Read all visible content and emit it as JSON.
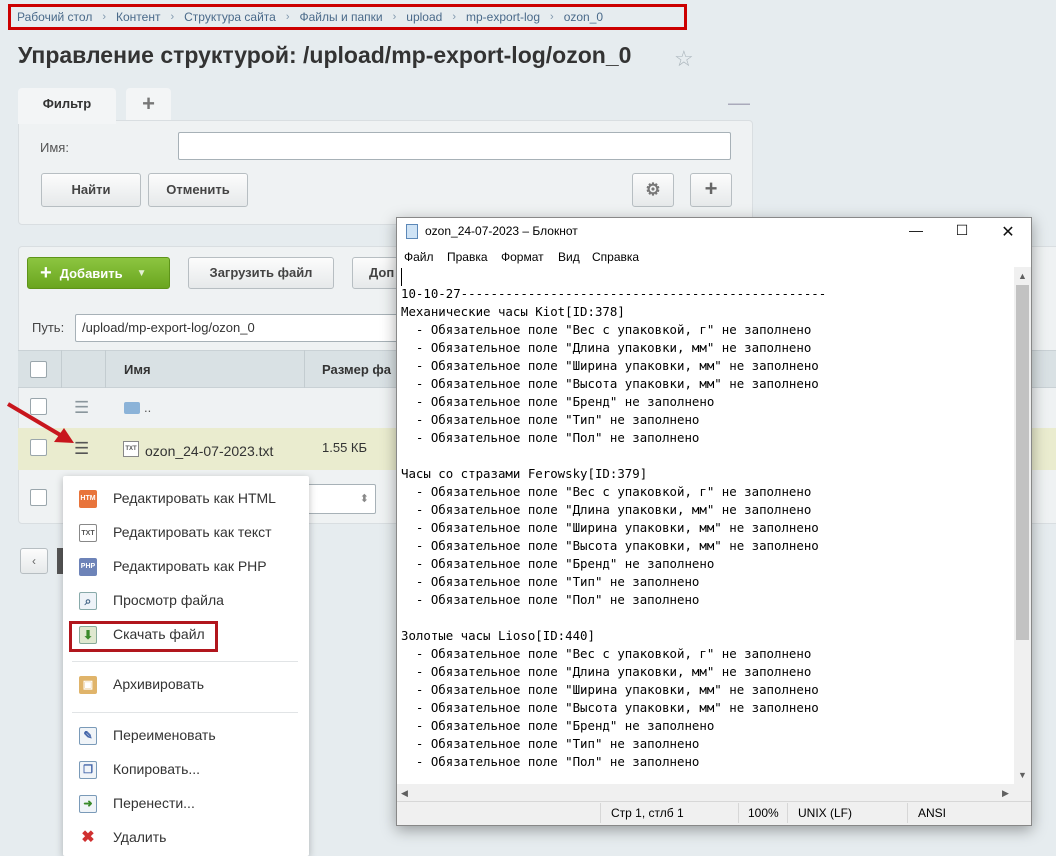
{
  "breadcrumb": [
    "Рабочий стол",
    "Контент",
    "Структура сайта",
    "Файлы и папки",
    "upload",
    "mp-export-log",
    "ozon_0"
  ],
  "page_title": "Управление структурой: /upload/mp-export-log/ozon_0",
  "filter": {
    "tab_label": "Фильтр",
    "name_label": "Имя:",
    "name_value": "",
    "find_label": "Найти",
    "cancel_label": "Отменить"
  },
  "toolbar": {
    "add_label": "Добавить",
    "upload_label": "Загрузить файл",
    "more_label": "Доп"
  },
  "path": {
    "label": "Путь:",
    "value": "/upload/mp-export-log/ozon_0"
  },
  "table": {
    "columns": [
      "Имя",
      "Размер фа"
    ],
    "parent": "..",
    "file": {
      "name": "ozon_24-07-2023.txt",
      "size": "1.55 КБ"
    }
  },
  "context_menu": {
    "items": [
      {
        "label": "Редактировать как HTML",
        "icon": "html-file-icon"
      },
      {
        "label": "Редактировать как текст",
        "icon": "txt-file-icon"
      },
      {
        "label": "Редактировать как PHP",
        "icon": "php-file-icon"
      },
      {
        "label": "Просмотр файла",
        "icon": "view-file-icon"
      },
      {
        "label": "Скачать файл",
        "icon": "download-icon"
      },
      {
        "label": "Архивировать",
        "icon": "archive-icon"
      },
      {
        "label": "Переименовать",
        "icon": "rename-icon"
      },
      {
        "label": "Копировать...",
        "icon": "copy-icon"
      },
      {
        "label": "Перенести...",
        "icon": "move-icon"
      },
      {
        "label": "Удалить",
        "icon": "delete-icon"
      }
    ]
  },
  "notepad": {
    "title": "ozon_24-07-2023 – Блокнот",
    "menu": [
      "Файл",
      "Правка",
      "Формат",
      "Вид",
      "Справка"
    ],
    "content": "10-10-27-------------------------------------------------\nМеханические часы Kiot[ID:378]\n  - Обязательное поле \"Вес с упаковкой, г\" не заполнено\n  - Обязательное поле \"Длина упаковки, мм\" не заполнено\n  - Обязательное поле \"Ширина упаковки, мм\" не заполнено\n  - Обязательное поле \"Высота упаковки, мм\" не заполнено\n  - Обязательное поле \"Бренд\" не заполнено\n  - Обязательное поле \"Тип\" не заполнено\n  - Обязательное поле \"Пол\" не заполнено\n\nЧасы со стразами Ferowsky[ID:379]\n  - Обязательное поле \"Вес с упаковкой, г\" не заполнено\n  - Обязательное поле \"Длина упаковки, мм\" не заполнено\n  - Обязательное поле \"Ширина упаковки, мм\" не заполнено\n  - Обязательное поле \"Высота упаковки, мм\" не заполнено\n  - Обязательное поле \"Бренд\" не заполнено\n  - Обязательное поле \"Тип\" не заполнено\n  - Обязательное поле \"Пол\" не заполнено\n\nЗолотые часы Lioso[ID:440]\n  - Обязательное поле \"Вес с упаковкой, г\" не заполнено\n  - Обязательное поле \"Длина упаковки, мм\" не заполнено\n  - Обязательное поле \"Ширина упаковки, мм\" не заполнено\n  - Обязательное поле \"Высота упаковки, мм\" не заполнено\n  - Обязательное поле \"Бренд\" не заполнено\n  - Обязательное поле \"Тип\" не заполнено\n  - Обязательное поле \"Пол\" не заполнено",
    "status": {
      "position": "Стр 1, стлб 1",
      "zoom": "100%",
      "line_endings": "UNIX (LF)",
      "encoding": "ANSI"
    }
  },
  "colors": {
    "highlight_red": "#c00000",
    "add_green": "#7ab530",
    "row_highlight": "#eaeccf"
  }
}
